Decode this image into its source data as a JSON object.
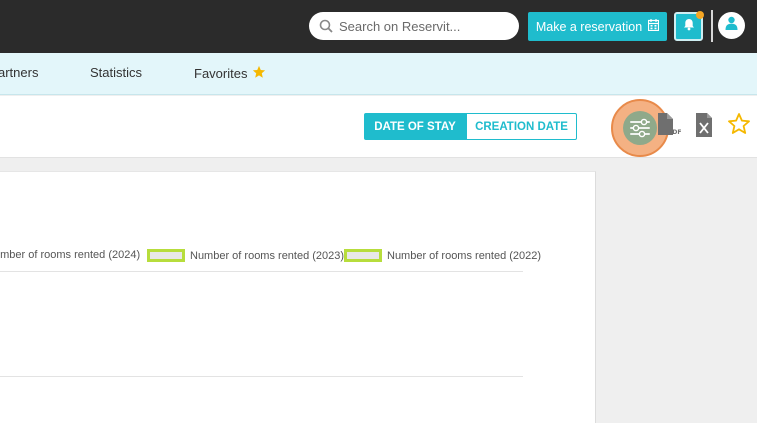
{
  "topbar": {
    "search_placeholder": "Search on Reservit...",
    "reserve_label": "Make a reservation"
  },
  "nav": {
    "partners": "artners",
    "statistics": "Statistics",
    "favorites": "Favorites"
  },
  "toolbar": {
    "tab_stay": "DATE OF STAY",
    "tab_created": "CREATION DATE"
  },
  "chart_data": {
    "type": "bar",
    "series": [
      {
        "name": "umber of rooms rented (2024)",
        "values": []
      },
      {
        "name": "Number of rooms rented (2023)",
        "values": []
      },
      {
        "name": "Number of rooms rented (2022)",
        "values": []
      }
    ],
    "legend_placement": "top",
    "grid": true
  },
  "colors": {
    "accent": "#1fbccd",
    "topbar": "#2b2b2b",
    "nav_bg": "#e3f6fa",
    "legend_border": "#b7dd3c",
    "highlight": "#f4b183",
    "star": "#f5b800"
  },
  "icons": [
    "search-icon",
    "calendar-icon",
    "bell-icon",
    "user-icon",
    "star-icon",
    "filter-icon",
    "pdf-icon",
    "excel-icon",
    "star-outline-icon"
  ]
}
